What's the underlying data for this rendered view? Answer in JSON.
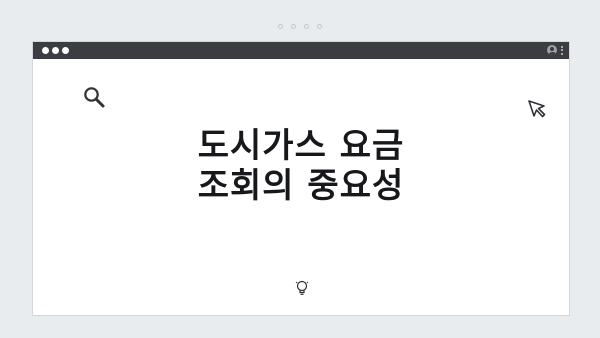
{
  "page": {
    "title_line1": "도시가스 요금",
    "title_line2": "조회의 중요성"
  },
  "icons": {
    "top": "pagination-dots-icon",
    "search": "magnifier-icon",
    "cursor": "cursor-arrow-icon",
    "bottom": "lightbulb-icon",
    "user": "user-icon",
    "menu": "kebab-menu-icon"
  },
  "colors": {
    "titlebar": "#3b3d42",
    "background": "#e9ecef",
    "text": "#16181b"
  }
}
